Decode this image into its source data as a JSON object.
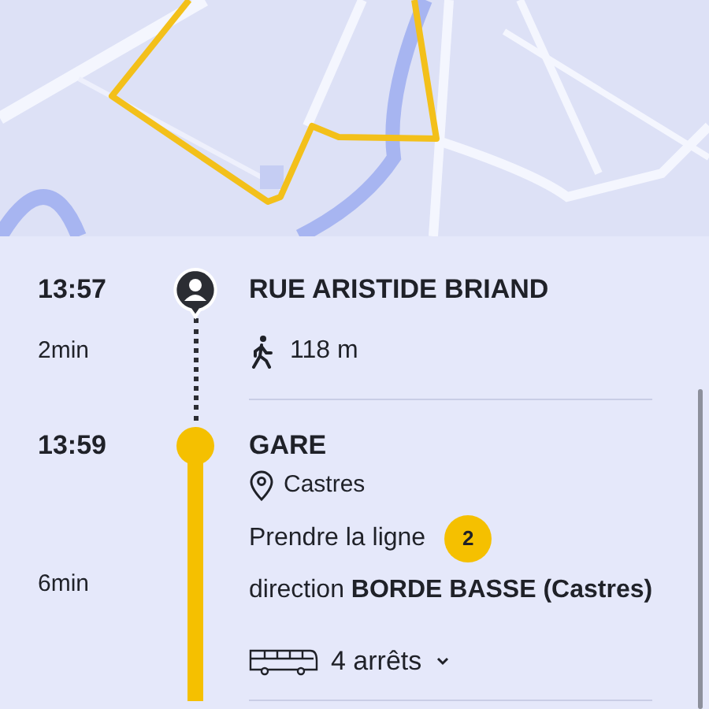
{
  "steps": [
    {
      "time": "13:57",
      "stop": "RUE ARISTIDE BRIAND",
      "kind": "person",
      "duration": "2min",
      "leg": {
        "kind": "walk",
        "distance": "118 m"
      }
    },
    {
      "time": "13:59",
      "stop": "GARE",
      "kind": "stop",
      "city": "Castres",
      "duration": "6min",
      "leg": {
        "kind": "bus",
        "instruction": "Prendre la ligne",
        "line": "2",
        "direction": "direction **BORDE BASSE (Castres)**",
        "stops": "4 arrêts",
        "expanded": false
      }
    }
  ]
}
